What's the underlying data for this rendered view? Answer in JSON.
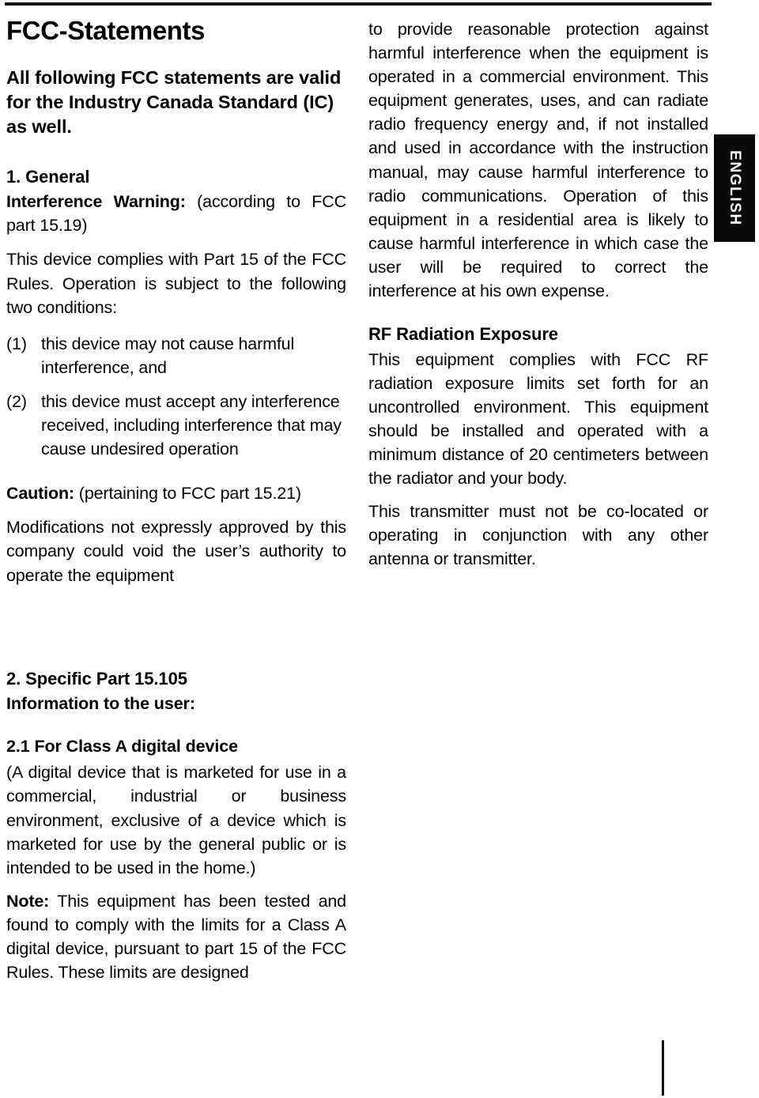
{
  "page": {
    "language_tab": "ENGLISH",
    "rule_color": "#111111",
    "tab_background": "#0a0a0a",
    "tab_text_color": "#ffffff"
  },
  "left_column": {
    "title": "FCC-Statements",
    "lede": "All following FCC statements are valid for the Industry Canada Standard (IC) as well.",
    "section_1": {
      "heading": "1. General",
      "warning_label": "Interference Warning:",
      "warning_ref": " (according to FCC part 15.19)",
      "intro": "This device complies with Part 15 of the FCC Rules. Operation is subject to the following two conditions:",
      "conditions": [
        {
          "marker": "(1)",
          "text": "this device may not cause harmful interference, and"
        },
        {
          "marker": "(2)",
          "text": "this device must accept any interference received, including interference that may cause undesired operation"
        }
      ],
      "caution_label": "Caution:",
      "caution_ref": " (pertaining to FCC part 15.21)",
      "caution_body": "Modifications not expressly approved by this company could void the user’s authority to operate the equipment"
    }
  },
  "right_column": {
    "continued_paragraph": "to provide reasonable protection against harmful interference when the equipment is operated in a commercial environment. This equipment generates, uses, and can radiate radio frequency energy and, if not installed and used in accordance with the instruction manual, may cause harmful interference to radio communications. Operation of this equipment in a residential area is likely to cause harmful interference in which case the user will be required to correct the interference at his own expense.",
    "rf_heading": "RF Radiation Exposure",
    "rf_paragraph_1": "This equipment complies with FCC RF radiation exposure limits set forth for an uncontrolled environment. This equipment should be installed and operated with a minimum distance of 20 centimeters between the radiator and your body.",
    "rf_paragraph_2": "This transmitter must not be co-located or operating in conjunction with any other antenna or transmitter."
  },
  "lower_left_column": {
    "section_2": {
      "heading": "2. Specific Part 15.105",
      "subheading": "Information to the user:",
      "item_2_1_heading": "2.1 For Class A digital device",
      "item_2_1_body": "(A digital device that is marketed for use in a commercial, industrial or business environment, exclusive of a device which is marketed for use by the general public or is intended to be used in the home.)",
      "note_label": "Note:",
      "note_body": " This equipment has been tested and found to comply with the limits for a Class A digital device, pursuant to part 15 of the FCC Rules. These limits are designed"
    }
  }
}
